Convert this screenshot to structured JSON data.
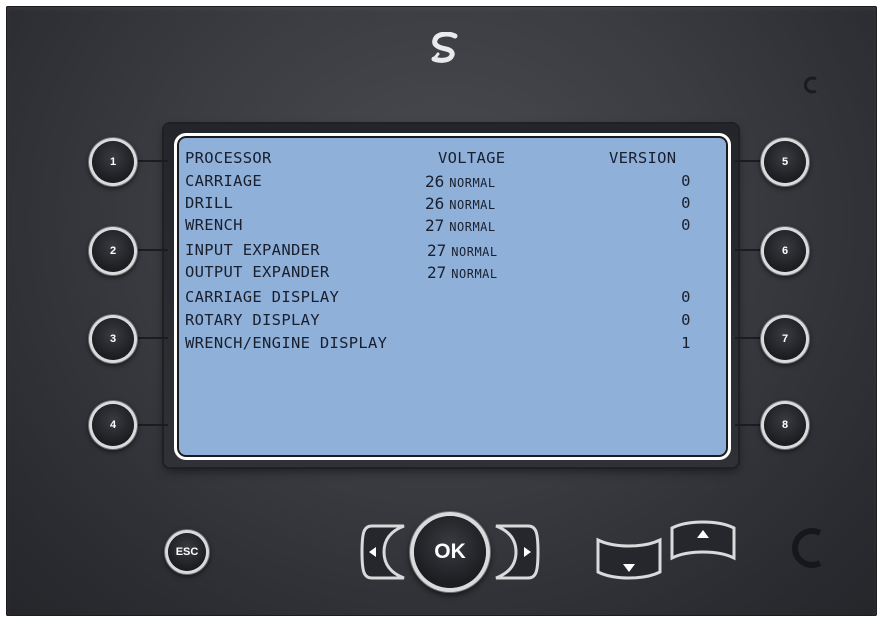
{
  "screen": {
    "header": {
      "processor": "PROCESSOR",
      "voltage": "VOLTAGE",
      "version": "VERSION"
    },
    "rows": [
      {
        "name": "CARRIAGE",
        "voltage": "26",
        "status": "NORMAL",
        "version": "0"
      },
      {
        "name": "DRILL",
        "voltage": "26",
        "status": "NORMAL",
        "version": "0"
      },
      {
        "name": "WRENCH",
        "voltage": "27",
        "status": "NORMAL",
        "version": "0"
      },
      {
        "name": "INPUT EXPANDER",
        "voltage": "27",
        "status": "NORMAL",
        "version": ""
      },
      {
        "name": "OUTPUT EXPANDER",
        "voltage": "27",
        "status": "NORMAL",
        "version": ""
      },
      {
        "name": "CARRIAGE DISPLAY",
        "voltage": "",
        "status": "",
        "version": "0"
      },
      {
        "name": "ROTARY DISPLAY",
        "voltage": "",
        "status": "",
        "version": "0"
      },
      {
        "name": "WRENCH/ENGINE DISPLAY",
        "voltage": "",
        "status": "",
        "version": "1"
      }
    ]
  },
  "softkeys": {
    "left": [
      "1",
      "2",
      "3",
      "4"
    ],
    "right": [
      "5",
      "6",
      "7",
      "8"
    ]
  },
  "controls": {
    "esc_label": "ESC",
    "ok_label": "OK",
    "left_icon": "arrow-left-icon",
    "right_icon": "arrow-right-icon",
    "down_icon": "arrow-down-icon",
    "up_icon": "arrow-up-icon"
  },
  "colors": {
    "screen_bg": "#8fb0d9",
    "bezel": "#3a3c42",
    "screen_text": "#1a1f2e"
  }
}
